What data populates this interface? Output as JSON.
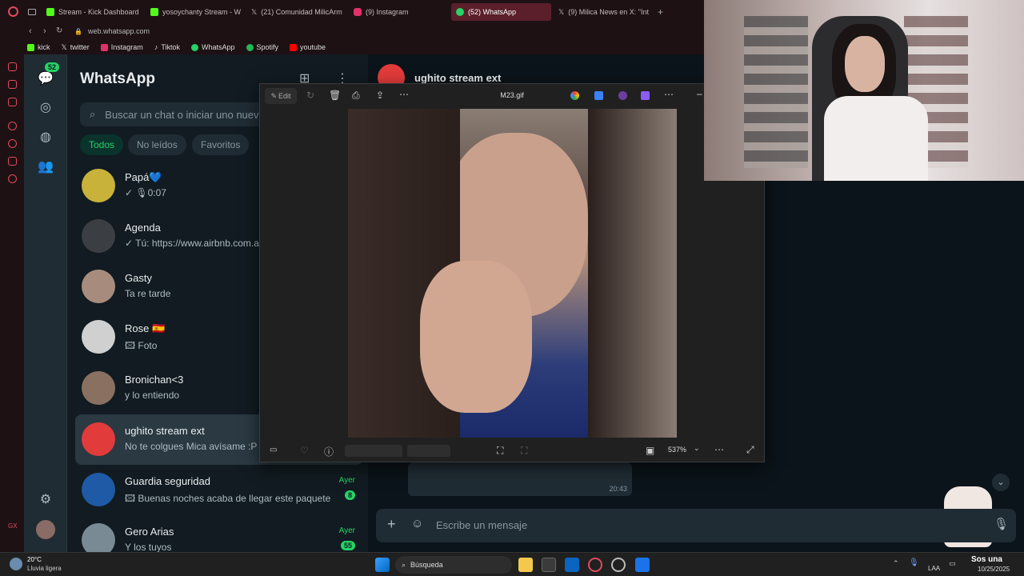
{
  "browser": {
    "tabs": [
      {
        "label": "Stream - Kick Dashboard",
        "color": "#53fc18"
      },
      {
        "label": "yosoychanty Stream - W",
        "color": "#53fc18"
      },
      {
        "label": "(21) Comunidad MilicArm",
        "color": "#ffffff"
      },
      {
        "label": "(9) Instagram",
        "color": "#e1306c"
      },
      {
        "label": "(52) WhatsApp",
        "color": "#25d366"
      },
      {
        "label": "(9) Milica News en X: \"Int",
        "color": "#ffffff"
      }
    ],
    "url": "web.whatsapp.com",
    "bookmarks": [
      {
        "label": "kick",
        "color": "#53fc18"
      },
      {
        "label": "twitter",
        "color": "#ffffff"
      },
      {
        "label": "Instagram",
        "color": "#e1306c"
      },
      {
        "label": "Tiktok",
        "color": "#ffffff"
      },
      {
        "label": "WhatsApp",
        "color": "#25d366"
      },
      {
        "label": "Spotify",
        "color": "#1db954"
      },
      {
        "label": "youtube",
        "color": "#ff0000"
      }
    ]
  },
  "whatsapp": {
    "title": "WhatsApp",
    "unread_badge": "52",
    "search_placeholder": "Buscar un chat o iniciar uno nuevo",
    "filters": [
      "Todos",
      "No leídos",
      "Favoritos"
    ],
    "chats": [
      {
        "name": "Papá💙",
        "msg": "✓ 🎙0:07",
        "time": "",
        "badge": "",
        "avatar": "#c8b23a"
      },
      {
        "name": "Agenda",
        "msg": "✓ Tú: https://www.airbnb.com.a",
        "time": "",
        "badge": "",
        "avatar": "#3b3f44"
      },
      {
        "name": "Gasty",
        "msg": "Ta re tarde",
        "time": "",
        "badge": "",
        "avatar": "#a78c7d"
      },
      {
        "name": "Rose 🇪🇸",
        "msg": "🖾 Foto",
        "time": "",
        "badge": "",
        "avatar": "#d0d0d0"
      },
      {
        "name": "Bronichan<3",
        "msg": "y lo entiendo",
        "time": "",
        "badge": "",
        "avatar": "#8a7060"
      },
      {
        "name": "ughito stream ext",
        "msg": "No te colgues Mica avísame :P",
        "time": "",
        "badge": "",
        "avatar": "#e23b3b"
      },
      {
        "name": "Guardia seguridad",
        "msg": "🖾 Buenas noches acaba de llegar este paquete",
        "time": "Ayer",
        "badge": "8",
        "avatar": "#1f5aa6"
      },
      {
        "name": "Gero Arias",
        "msg": "Y los tuyos",
        "time": "Ayer",
        "badge": "55",
        "avatar": "#7a8a95"
      }
    ],
    "active_chat": "ughito stream ext",
    "message_time": "20:43",
    "composer_placeholder": "Escribe un mensaje"
  },
  "viewer": {
    "edit_label": "Edit",
    "filename": "M23.gif",
    "zoom": "537%"
  },
  "taskbar": {
    "weather_temp": "20°C",
    "weather_desc": "Lluvia ligera",
    "search_label": "Búsqueda",
    "lang": "LAA",
    "date": "10/25/2025",
    "notification": "Sos una"
  }
}
